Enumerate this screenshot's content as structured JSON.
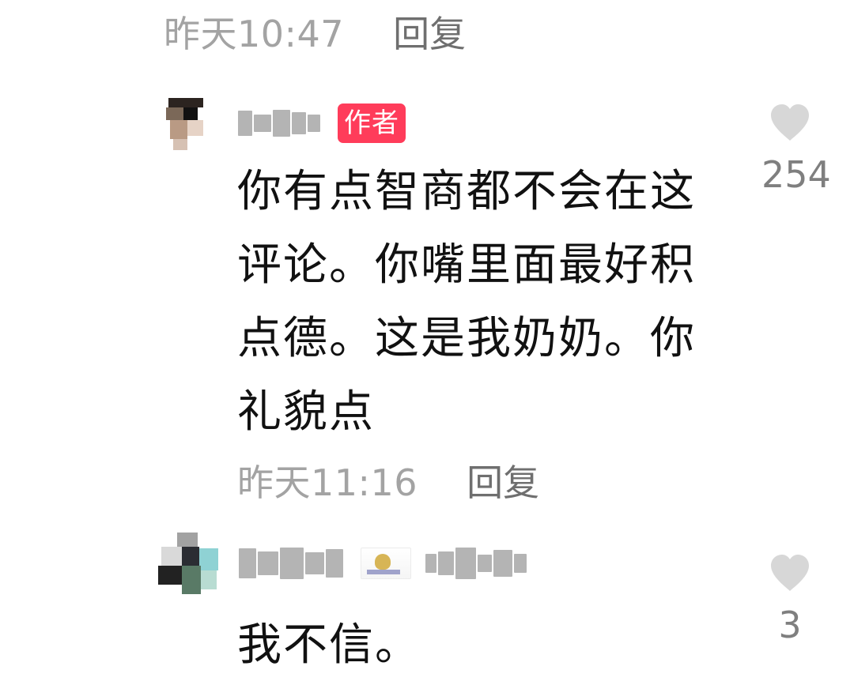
{
  "top_meta": {
    "time": "昨天10:47",
    "reply": "回复"
  },
  "comments": [
    {
      "author_badge": "作者",
      "text": "你有点智商都不会在这\n评论。你嘴里面最好积\n点德。这是我奶奶。你\n礼貌点",
      "likes": "254",
      "time": "昨天11:16",
      "reply": "回复"
    },
    {
      "text": "我不信。",
      "likes": "3"
    }
  ],
  "icons": {
    "heart": "heart-icon",
    "flag": "flag-icon"
  },
  "colors": {
    "author_badge": "#ff3c5a",
    "muted_text": "#a3a3a3",
    "icon_gray": "#d7d7d7"
  }
}
